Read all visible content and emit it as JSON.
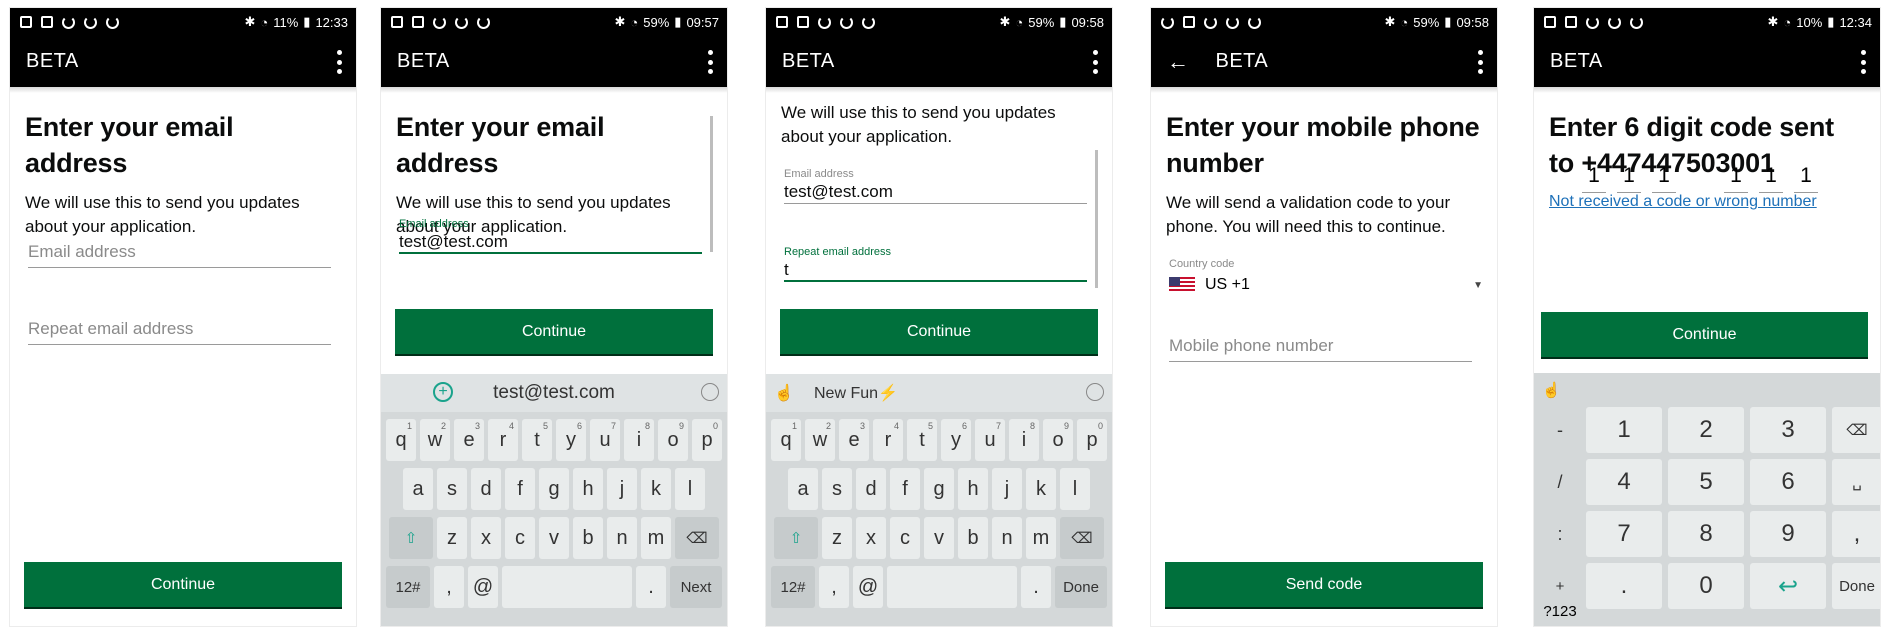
{
  "common": {
    "app_title": "BETA"
  },
  "screens": [
    {
      "status_battery": "11%",
      "status_time": "12:33",
      "title": "Enter your email address",
      "body": "We will use this to send you updates about your application.",
      "email_placeholder": "Email address",
      "repeat_placeholder": "Repeat email address",
      "button": "Continue"
    },
    {
      "status_battery": "59%",
      "status_time": "09:57",
      "title": "Enter your email address",
      "body": "We will use this to send you updates about your application.",
      "email_label": "Email address",
      "email_value": "test@test.com",
      "button": "Continue",
      "suggestion": "test@test.com",
      "action_key": "Next"
    },
    {
      "status_battery": "59%",
      "status_time": "09:58",
      "body": "We will use this to send you updates about your application.",
      "email_label": "Email address",
      "email_value": "test@test.com",
      "repeat_label": "Repeat email address",
      "repeat_value": "t",
      "button": "Continue",
      "suggestion": "New Fun⚡",
      "action_key": "Done"
    },
    {
      "status_battery": "59%",
      "status_time": "09:58",
      "title": "Enter your mobile phone number",
      "body": "We will send a validation code to your phone. You will need this to continue.",
      "country_label": "Country code",
      "country_value": "US +1",
      "phone_placeholder": "Mobile phone number",
      "button": "Send code"
    },
    {
      "status_battery": "10%",
      "status_time": "12:34",
      "title": "Enter 6 digit code sent to +447447503001",
      "link": "Not received a code or wrong number",
      "code_digits": [
        "1",
        "1",
        "1",
        "1",
        "1",
        "1"
      ],
      "button": "Continue",
      "numpad": {
        "side": [
          "-",
          "/",
          ":",
          "+",
          "?123"
        ],
        "digits": [
          "1",
          "2",
          "3",
          "4",
          "5",
          "6",
          "7",
          "8",
          "9",
          "0"
        ],
        "comma": ",",
        "period": ".",
        "done": "Done"
      }
    }
  ],
  "keyboard": {
    "row1": [
      "q",
      "w",
      "e",
      "r",
      "t",
      "y",
      "u",
      "i",
      "o",
      "p"
    ],
    "row1_sup": [
      "1",
      "2",
      "3",
      "4",
      "5",
      "6",
      "7",
      "8",
      "9",
      "0"
    ],
    "row2": [
      "a",
      "s",
      "d",
      "f",
      "g",
      "h",
      "j",
      "k",
      "l"
    ],
    "row3": [
      "z",
      "x",
      "c",
      "v",
      "b",
      "n",
      "m"
    ],
    "sym_key": "12#",
    "at_key": "@",
    "comma_key": ",",
    "period_key": "."
  }
}
